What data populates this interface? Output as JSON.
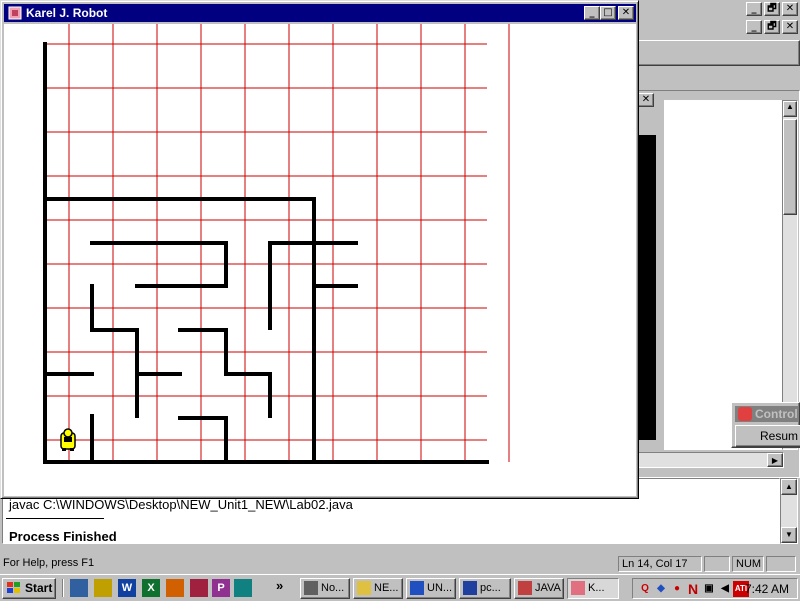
{
  "karel_window": {
    "title": "Karel J. Robot",
    "buttons": {
      "minimize": "_",
      "maximize": "□",
      "close": "✕"
    }
  },
  "background_ide": {
    "window_buttons": {
      "minimize": "_",
      "restore": "🗗",
      "close": "✕"
    },
    "inner_close": "✕",
    "output": {
      "line1": "javac C:\\WINDOWS\\Desktop\\NEW_Unit1_NEW\\Lab02.java",
      "line3": "Process Finished"
    },
    "control_window": {
      "title": "Control",
      "button": "Resum"
    }
  },
  "statusbar": {
    "help": "For Help, press F1",
    "position": "Ln 14, Col 17",
    "num": "NUM"
  },
  "taskbar": {
    "start": "Start",
    "chevron": "»",
    "tasks": [
      {
        "label": "No...",
        "icon": "notepad-icon"
      },
      {
        "label": "NE...",
        "icon": "folder-icon"
      },
      {
        "label": "UN...",
        "icon": "word-icon"
      },
      {
        "label": "pc...",
        "icon": "pc-icon"
      },
      {
        "label": "JAVA",
        "icon": "java-icon"
      },
      {
        "label": "K...",
        "icon": "karel-icon"
      }
    ],
    "clock": "7:42 AM"
  },
  "world": {
    "streets": 10,
    "avenues": 10,
    "robot": {
      "street": 1,
      "avenue": 1,
      "facing": "north"
    },
    "colors": {
      "grid": "#cc0000",
      "walls": "#000000",
      "robot_body": "#ffff00"
    }
  }
}
